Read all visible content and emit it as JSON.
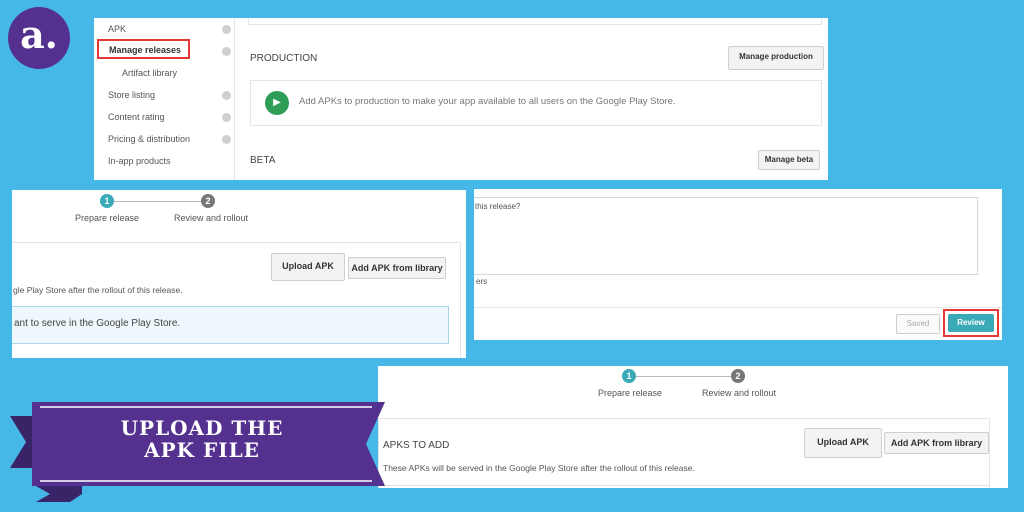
{
  "logo": {
    "letter": "a."
  },
  "colors": {
    "background": "#45b8e7",
    "accent": "#3aa9b8",
    "banner": "#54318f",
    "highlight": "#e53935"
  },
  "panel1": {
    "sidebar": [
      {
        "label": "APK"
      },
      {
        "label": "Manage releases"
      },
      {
        "label": "Artifact library"
      },
      {
        "label": "Store listing"
      },
      {
        "label": "Content rating"
      },
      {
        "label": "Pricing & distribution"
      },
      {
        "label": "In-app products"
      }
    ],
    "production_heading": "PRODUCTION",
    "manage_production": "Manage production",
    "production_message": "Add APKs to production to make your app available to all users on the Google Play Store.",
    "beta_heading": "BETA",
    "manage_beta": "Manage beta"
  },
  "panel2": {
    "steps": [
      {
        "number": "1",
        "label": "Prepare release"
      },
      {
        "number": "2",
        "label": "Review and rollout"
      }
    ],
    "upload_apk": "Upload APK",
    "add_from_library": "Add APK from library",
    "served_text": "gle Play Store after the rollout of this release.",
    "info_text": "ant to serve in the Google Play Store."
  },
  "panel3": {
    "textarea_text": "this release?",
    "below_text": "ers",
    "saved": "Saved",
    "review": "Review"
  },
  "panel4": {
    "steps": [
      {
        "number": "1",
        "label": "Prepare release"
      },
      {
        "number": "2",
        "label": "Review and rollout"
      }
    ],
    "apks_heading": "APKS TO ADD",
    "upload_apk": "Upload APK",
    "add_from_library": "Add APK from library",
    "served_text": "These APKs will be served in the Google Play Store after the rollout of this release."
  },
  "banner": {
    "line1": "UPLOAD THE",
    "line2": "APK FILE"
  }
}
